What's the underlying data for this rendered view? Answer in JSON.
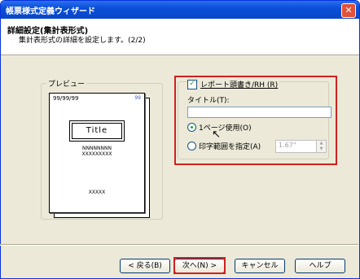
{
  "window": {
    "title": "帳票様式定義ウィザード"
  },
  "header": {
    "title": "詳細設定(集計表形式)",
    "subtitle": "集計表形式の詳細を設定します。(2/2)"
  },
  "preview": {
    "label": "プレビュー",
    "date": "99/99/99",
    "page_num": "99",
    "title_text": "Title",
    "line1": "NNNNNNNN",
    "line2": "XXXXXXXXX",
    "footer": "XXXXX"
  },
  "settings": {
    "report_heading_label": "レポート頭書き/RH (R)",
    "report_heading_checked": true,
    "title_field_label": "タイトル(T):",
    "title_field_value": "",
    "radio_one_page": "1ページ使用(O)",
    "radio_one_page_selected": true,
    "radio_print_range": "印字範囲を指定(A)",
    "radio_print_range_selected": false,
    "range_value": "1.67\""
  },
  "buttons": {
    "back": "< 戻る(B)",
    "next": "次へ(N) >",
    "cancel": "キャンセル",
    "help": "ヘルプ"
  },
  "colors": {
    "highlight": "#d02020",
    "titlebar": "#0a4fd8"
  }
}
